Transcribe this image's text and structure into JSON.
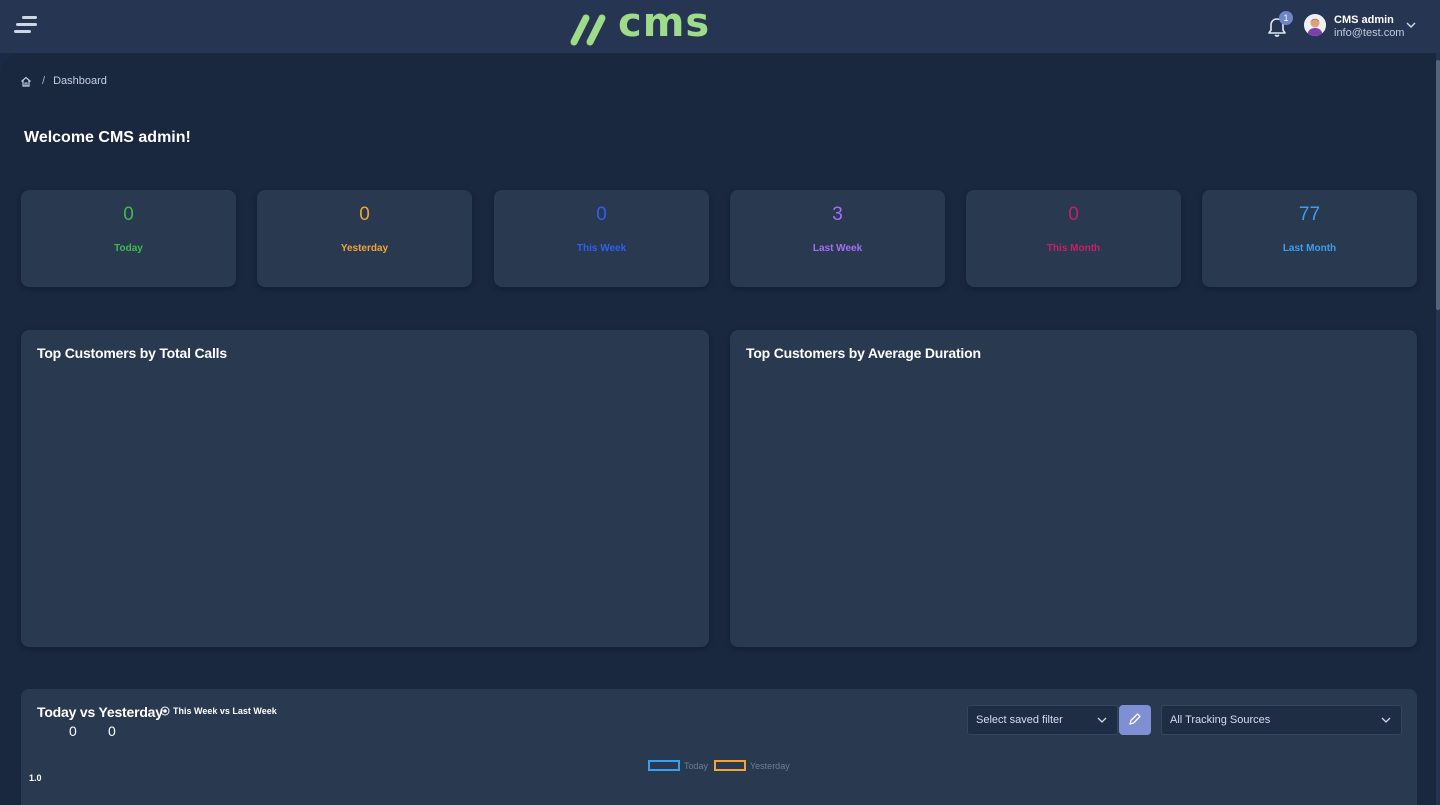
{
  "header": {
    "logo_text": "cms",
    "notification_count": "1",
    "user_name": "CMS admin",
    "user_email": "info@test.com"
  },
  "breadcrumb": {
    "current": "Dashboard",
    "separator": "/"
  },
  "welcome": "Welcome CMS admin!",
  "stats": [
    {
      "value": "0",
      "label": "Today",
      "color": "#3fb950"
    },
    {
      "value": "0",
      "label": "Yesterday",
      "color": "#f0a43a"
    },
    {
      "value": "0",
      "label": "This Week",
      "color": "#2f5ff0"
    },
    {
      "value": "3",
      "label": "Last Week",
      "color": "#a66ef5"
    },
    {
      "value": "0",
      "label": "This Month",
      "color": "#c71f6a"
    },
    {
      "value": "77",
      "label": "Last Month",
      "color": "#3c9ef0"
    }
  ],
  "panels": {
    "left_title": "Top Customers by Total Calls",
    "right_title": "Top Customers by Average Duration"
  },
  "comparison": {
    "title": "Today vs Yesterday",
    "toggle_label": "This Week vs Last Week",
    "today_value": "0",
    "yesterday_value": "0",
    "saved_filter_placeholder": "Select saved filter",
    "tracking_sources": "All Tracking Sources",
    "legend": [
      {
        "label": "Today",
        "color": "#3c9ef0"
      },
      {
        "label": "Yesterday",
        "color": "#f0a43a"
      }
    ],
    "y_tick": "1.0"
  },
  "colors": {
    "accent": "#9fdc8a",
    "edit_button": "#7e8fd3"
  }
}
